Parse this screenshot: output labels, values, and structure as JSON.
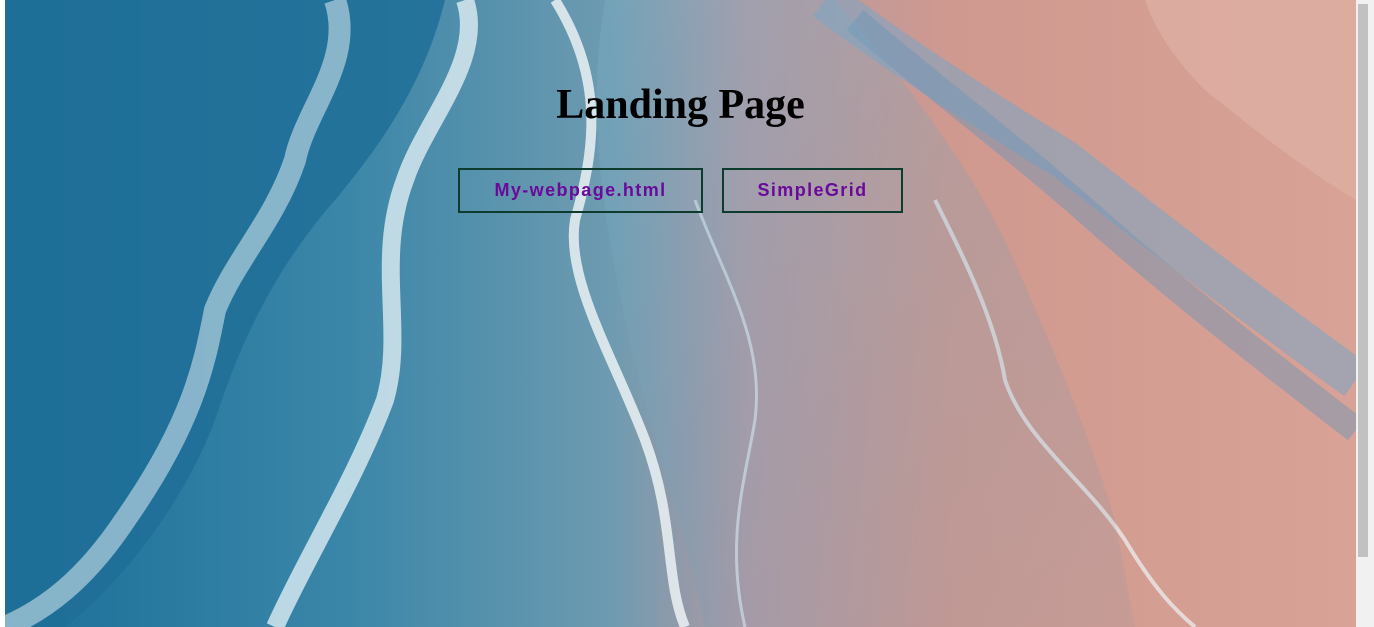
{
  "page": {
    "title": "Landing Page"
  },
  "links": [
    {
      "label": "My-webpage.html"
    },
    {
      "label": "SimpleGrid"
    }
  ],
  "colors": {
    "link_text": "#6a0a9b",
    "link_border": "#0d3b2e",
    "ocean_deep": "#1f6f96",
    "sand": "#d79a8c"
  },
  "background": {
    "subject": "aerial view of ocean waves on sandy beach"
  }
}
